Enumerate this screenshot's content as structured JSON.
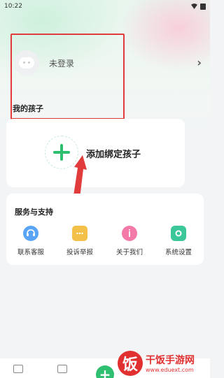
{
  "status_bar": {
    "time": "10:22"
  },
  "profile": {
    "login_status": "未登录"
  },
  "kids": {
    "section_title": "我的孩子",
    "add_child_label": "添加绑定孩子"
  },
  "services": {
    "title": "服务与支持",
    "items": [
      {
        "label": "联系客服",
        "icon": "headset-icon",
        "color": "#5aa4f5"
      },
      {
        "label": "投诉举报",
        "icon": "chat-bubble-icon",
        "color": "#f3c04a"
      },
      {
        "label": "关于我们",
        "icon": "info-icon",
        "color": "#f37aa8"
      },
      {
        "label": "系统设置",
        "icon": "gear-icon",
        "color": "#3cc79a"
      }
    ]
  },
  "bottom_nav": {
    "fab_label": "+"
  },
  "watermark": {
    "logo_char": "饭",
    "title": "干饭手游网",
    "url": "www.eduext.com"
  },
  "colors": {
    "accent": "#2fbf71",
    "annotation": "#e23b3b"
  }
}
